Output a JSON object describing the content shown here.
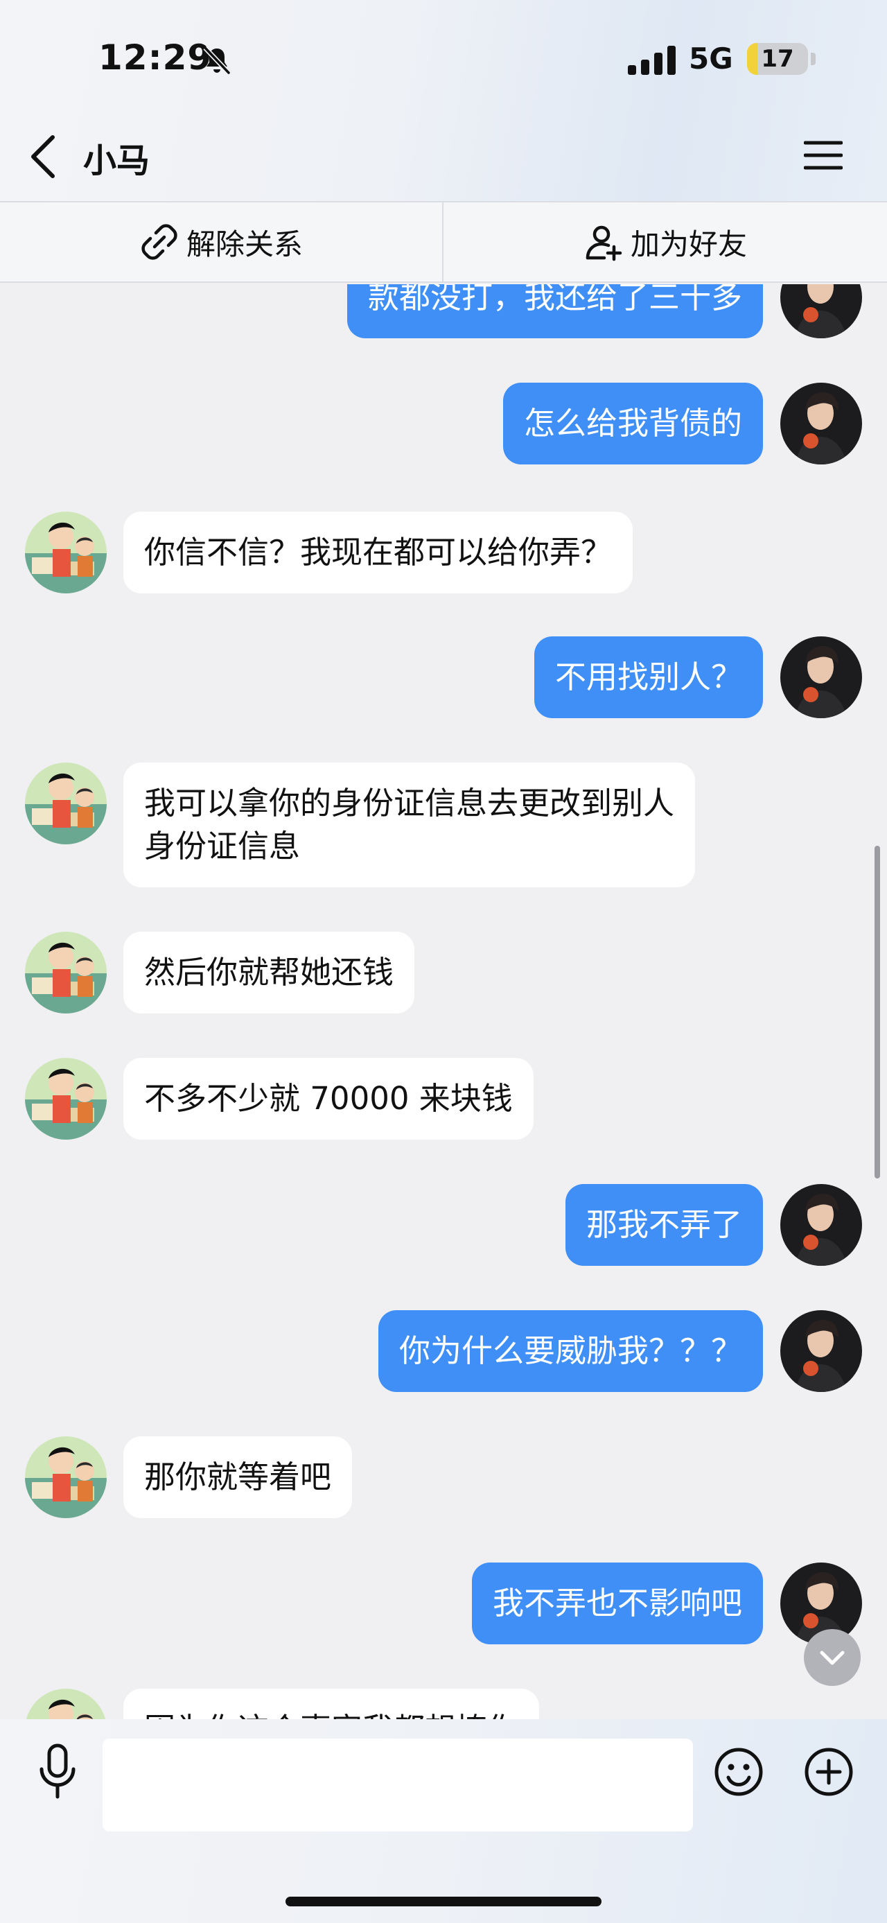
{
  "status_bar": {
    "time": "12:29",
    "network": "5G",
    "battery": "17",
    "battery_level": 0.17,
    "muted": true
  },
  "header": {
    "title": "小马",
    "back_icon": "chevron-left-icon",
    "menu_icon": "hamburger-menu-icon"
  },
  "actions": {
    "unlink_label": "解除关系",
    "unlink_icon": "unlink-icon",
    "add_friend_label": "加为好友",
    "add_friend_icon": "add-user-icon"
  },
  "messages": [
    {
      "side": "right",
      "text": "款都没打，我还给了三十多"
    },
    {
      "side": "right",
      "text": "怎么给我背债的"
    },
    {
      "side": "left",
      "text": "你信不信？我现在都可以给你弄？"
    },
    {
      "side": "right",
      "text": "不用找别人？"
    },
    {
      "side": "left",
      "lines": [
        "我可以拿你的身份证信息去更改到别人",
        "身份证信息"
      ]
    },
    {
      "side": "left",
      "text": "然后你就帮她还钱"
    },
    {
      "side": "left",
      "text": "不多不少就 70000 来块钱"
    },
    {
      "side": "right",
      "text": "那我不弄了"
    },
    {
      "side": "right",
      "text": "你为什么要威胁我？？？"
    },
    {
      "side": "left",
      "text": "那你就等着吧"
    },
    {
      "side": "right",
      "text": "我不弄也不影响吧"
    },
    {
      "side": "left",
      "text": "因为你这个事害我都想撩你"
    }
  ],
  "input": {
    "value": "",
    "placeholder": "",
    "mic_icon": "microphone-icon",
    "emoji_icon": "smiley-icon",
    "plus_icon": "plus-circle-icon"
  },
  "colors": {
    "sent_bubble": "#3f8ff7",
    "received_bubble": "#ffffff",
    "chat_background": "#f0f0f2"
  }
}
